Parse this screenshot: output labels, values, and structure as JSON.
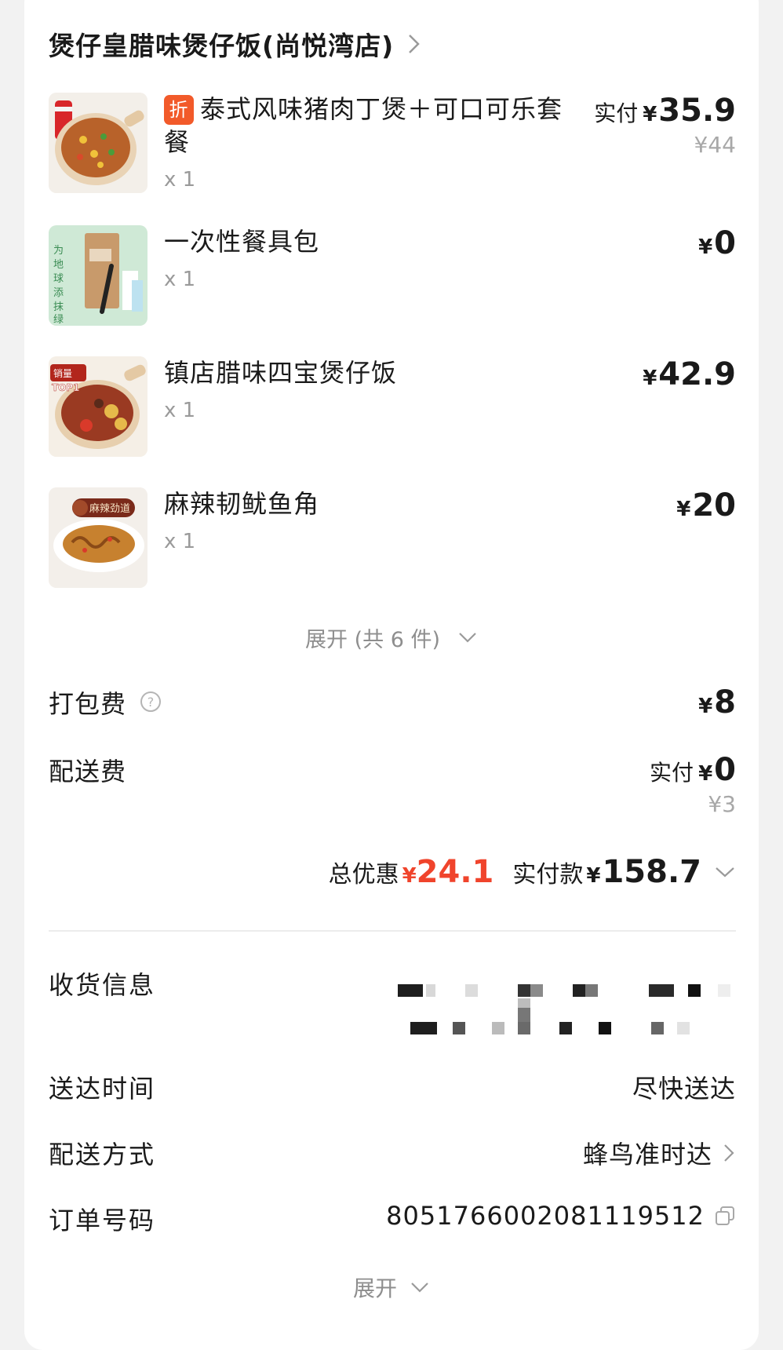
{
  "store": {
    "name": "煲仔皇腊味煲仔饭(尚悦湾店)"
  },
  "items": [
    {
      "badge": "折",
      "name": "泰式风味猪肉丁煲＋可口可乐套餐",
      "qty": "x 1",
      "price_prefix": "实付",
      "currency": "¥",
      "price": "35.9",
      "original_price": "¥44",
      "image": "clay-pot-rice-with-cola"
    },
    {
      "name": "一次性餐具包",
      "qty": "x 1",
      "currency": "¥",
      "price": "0",
      "image": "tableware-pack",
      "image_text": "为地球添抹绿"
    },
    {
      "name": "镇店腊味四宝煲仔饭",
      "qty": "x 1",
      "currency": "¥",
      "price": "42.9",
      "image": "claypot-rice-top1",
      "image_text": "销量TOP1"
    },
    {
      "name": "麻辣韧鱿鱼角",
      "qty": "x 1",
      "currency": "¥",
      "price": "20",
      "image": "spicy-squid",
      "image_text": "麻辣劲道"
    }
  ],
  "expand_items": {
    "label": "展开 (共 6 件)"
  },
  "fees": {
    "packing": {
      "label": "打包费",
      "currency": "¥",
      "value": "8"
    },
    "delivery": {
      "label": "配送费",
      "prefix": "实付",
      "currency": "¥",
      "value": "0",
      "original": "¥3"
    }
  },
  "summary": {
    "discount_label": "总优惠",
    "currency": "¥",
    "discount_value": "24.1",
    "paid_label": "实付款",
    "paid_value": "158.7"
  },
  "info": {
    "receiver": {
      "label": "收货信息"
    },
    "delivery_time": {
      "label": "送达时间",
      "value": "尽快送达"
    },
    "delivery_method": {
      "label": "配送方式",
      "value": "蜂鸟准时达"
    },
    "order_no": {
      "label": "订单号码",
      "value": "8051766002081119512"
    }
  },
  "expand_more": {
    "label": "展开"
  },
  "colors": {
    "accent_red": "#f0442c",
    "badge_orange": "#f25a2a",
    "muted": "#9a9a9a"
  }
}
